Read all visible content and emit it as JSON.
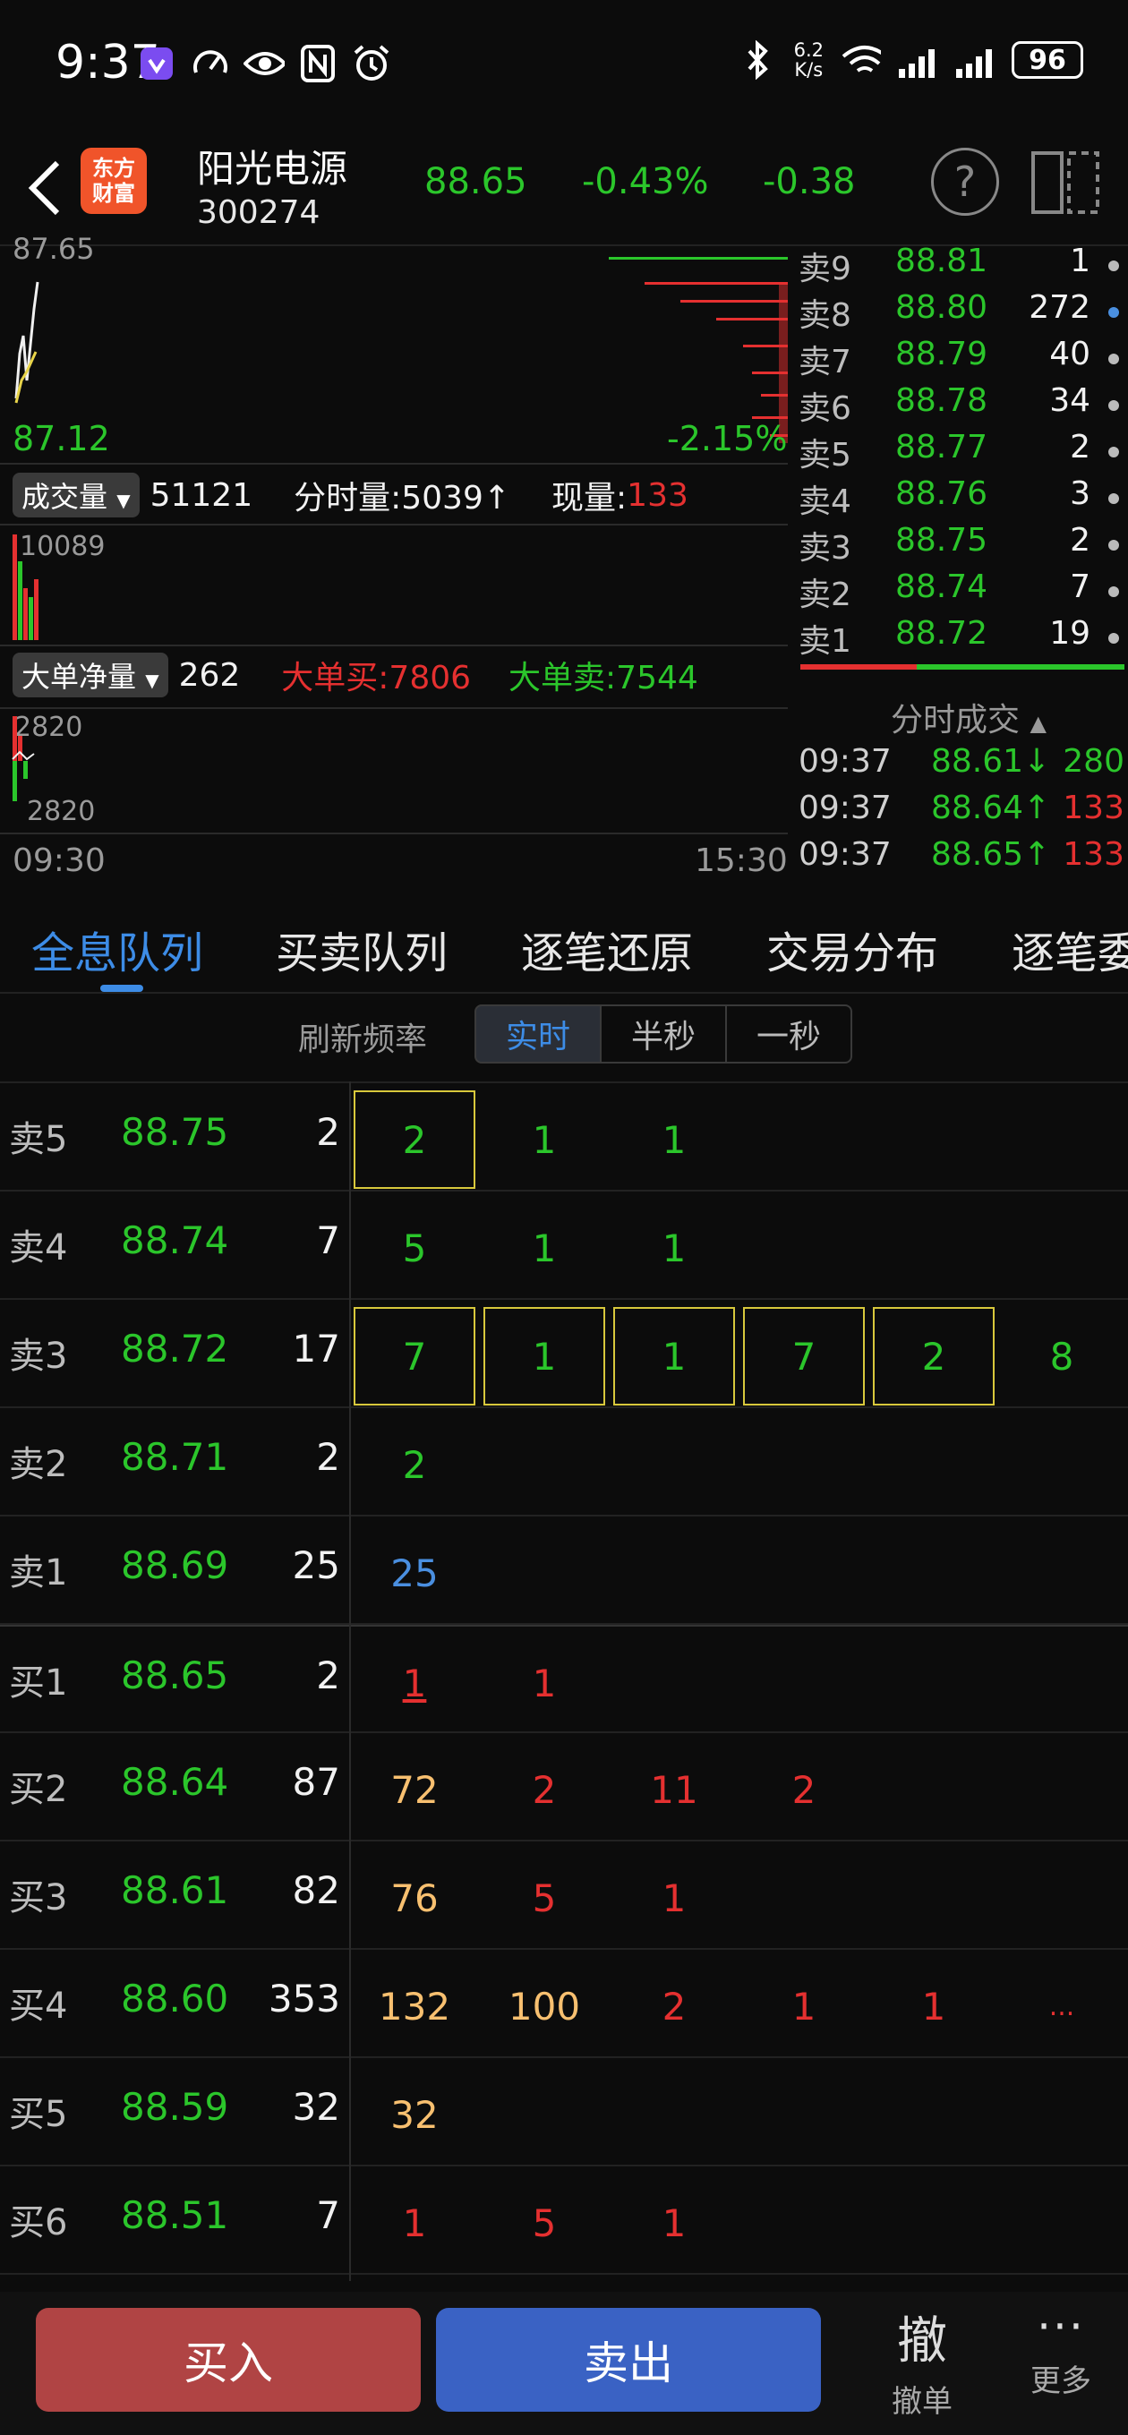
{
  "status": {
    "time": "9:37",
    "net_speed_value": "6.2",
    "net_speed_unit": "K/s",
    "battery": "96"
  },
  "header": {
    "logo_line1": "东方",
    "logo_line2": "财富",
    "stock_name": "阳光电源",
    "stock_code": "300274",
    "price": "88.65",
    "pct": "-0.43%",
    "change": "-0.38",
    "help": "?"
  },
  "chart": {
    "top_label": "87.65",
    "low_price": "87.12",
    "low_pct": "-2.15%",
    "vol_pill": "成交量",
    "vol_value": "51121",
    "vol_interval": "分时量:5039↑",
    "vol_now_label": "现量:",
    "vol_now_value": "133",
    "vol_scale": "10089",
    "net_pill": "大单净量",
    "net_value": "262",
    "big_buy": "大单买:7806",
    "big_sell": "大单卖:7544",
    "net_top": "2820",
    "net_bottom": "2820",
    "time_start": "09:30",
    "time_end": "15:30"
  },
  "book": {
    "asks": [
      {
        "label": "卖9",
        "price": "88.81",
        "vol": "1"
      },
      {
        "label": "卖8",
        "price": "88.80",
        "vol": "272"
      },
      {
        "label": "卖7",
        "price": "88.79",
        "vol": "40"
      },
      {
        "label": "卖6",
        "price": "88.78",
        "vol": "34"
      },
      {
        "label": "卖5",
        "price": "88.77",
        "vol": "2"
      },
      {
        "label": "卖4",
        "price": "88.76",
        "vol": "3"
      },
      {
        "label": "卖3",
        "price": "88.75",
        "vol": "2"
      },
      {
        "label": "卖2",
        "price": "88.74",
        "vol": "7"
      },
      {
        "label": "卖1",
        "price": "88.72",
        "vol": "19"
      }
    ],
    "ticks_title": "分时成交",
    "ticks": [
      {
        "time": "09:37",
        "price": "88.61↓",
        "vol": "280"
      },
      {
        "time": "09:37",
        "price": "88.64↑",
        "vol": "133"
      },
      {
        "time": "09:37",
        "price": "88.65↑",
        "vol": "133"
      }
    ]
  },
  "tabs": [
    "全息队列",
    "买卖队列",
    "逐笔还原",
    "交易分布",
    "逐笔委"
  ],
  "freq": {
    "label": "刷新频率",
    "options": [
      "实时",
      "半秒",
      "一秒"
    ]
  },
  "queue": [
    {
      "label": "卖5",
      "price": "88.75",
      "vol": "2",
      "cells": [
        "2",
        "1",
        "1"
      ]
    },
    {
      "label": "卖4",
      "price": "88.74",
      "vol": "7",
      "cells": [
        "5",
        "1",
        "1"
      ]
    },
    {
      "label": "卖3",
      "price": "88.72",
      "vol": "17",
      "cells": [
        "7",
        "1",
        "1",
        "7",
        "2",
        "8"
      ]
    },
    {
      "label": "卖2",
      "price": "88.71",
      "vol": "2",
      "cells": [
        "2"
      ]
    },
    {
      "label": "卖1",
      "price": "88.69",
      "vol": "25",
      "cells": [
        "25"
      ]
    },
    {
      "label": "买1",
      "price": "88.65",
      "vol": "2",
      "cells": [
        "1",
        "1"
      ]
    },
    {
      "label": "买2",
      "price": "88.64",
      "vol": "87",
      "cells": [
        "72",
        "2",
        "11",
        "2"
      ]
    },
    {
      "label": "买3",
      "price": "88.61",
      "vol": "82",
      "cells": [
        "76",
        "5",
        "1"
      ]
    },
    {
      "label": "买4",
      "price": "88.60",
      "vol": "353",
      "cells": [
        "132",
        "100",
        "2",
        "1",
        "1",
        "..."
      ]
    },
    {
      "label": "买5",
      "price": "88.59",
      "vol": "32",
      "cells": [
        "32"
      ]
    },
    {
      "label": "买6",
      "price": "88.51",
      "vol": "7",
      "cells": [
        "1",
        "5",
        "1"
      ]
    }
  ],
  "bottom": {
    "buy": "买入",
    "sell": "卖出",
    "cancel_glyph": "撤",
    "cancel": "撤单",
    "more": "更多"
  },
  "colors": {
    "up": "#e53030",
    "down": "#2bc62b",
    "accent": "#3d8ce6",
    "buy_btn": "#b04444",
    "sell_btn": "#3a62c4"
  }
}
